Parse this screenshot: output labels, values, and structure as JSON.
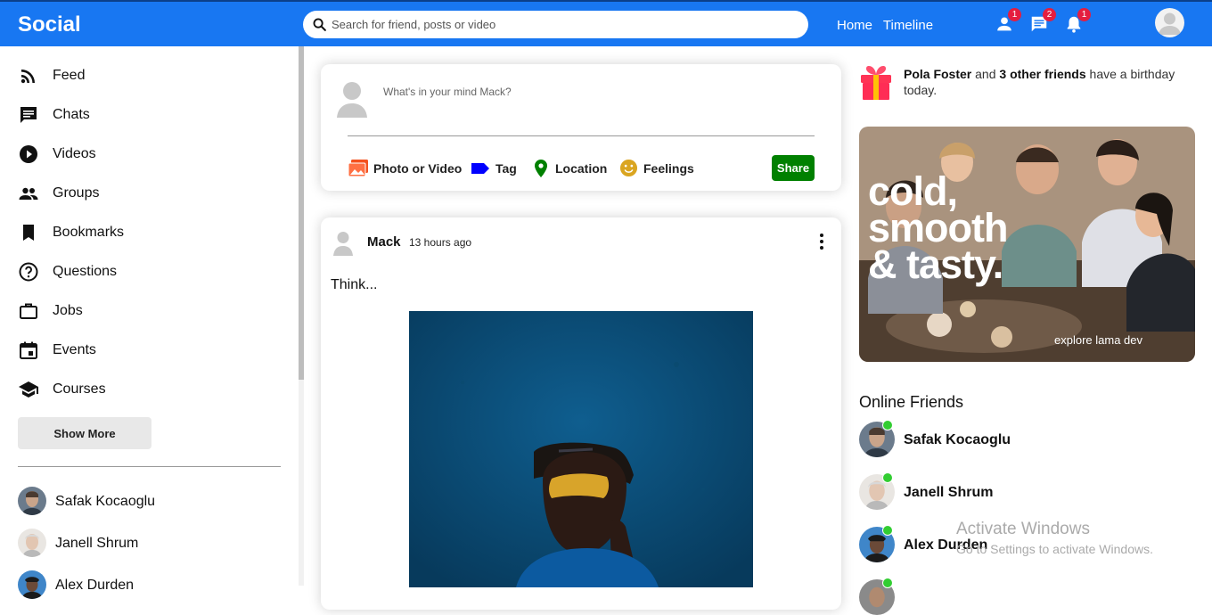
{
  "topbar": {
    "logo": "Social",
    "search_placeholder": "Search for friend, posts or video",
    "links": [
      "Home",
      "Timeline"
    ],
    "badges": {
      "person": "1",
      "chat": "2",
      "notifications": "1"
    }
  },
  "sidebar": {
    "items": [
      {
        "label": "Feed",
        "icon": "rss-feed-icon"
      },
      {
        "label": "Chats",
        "icon": "chat-icon"
      },
      {
        "label": "Videos",
        "icon": "play-circle-icon"
      },
      {
        "label": "Groups",
        "icon": "group-icon"
      },
      {
        "label": "Bookmarks",
        "icon": "bookmark-icon"
      },
      {
        "label": "Questions",
        "icon": "help-circle-icon"
      },
      {
        "label": "Jobs",
        "icon": "work-icon"
      },
      {
        "label": "Events",
        "icon": "event-icon"
      },
      {
        "label": "Courses",
        "icon": "school-icon"
      }
    ],
    "show_more": "Show More",
    "friends": [
      "Safak Kocaoglu",
      "Janell Shrum",
      "Alex Durden"
    ]
  },
  "share": {
    "placeholder": "What's in your mind Mack?",
    "options": [
      "Photo or Video",
      "Tag",
      "Location",
      "Feelings"
    ],
    "share_button": "Share"
  },
  "post": {
    "username": "Mack",
    "time": "13 hours ago",
    "text": "Think..."
  },
  "rightbar": {
    "birthday": {
      "name": "Pola Foster",
      "middle": " and ",
      "others": "3 other friends",
      "suffix": " have a birthday today."
    },
    "ad": {
      "headline_1": "cold,",
      "headline_2": "smooth",
      "headline_3": "& tasty.",
      "sub": "explore lama dev"
    },
    "online_title": "Online Friends",
    "online": [
      "Safak Kocaoglu",
      "Janell Shrum",
      "Alex Durden"
    ]
  },
  "watermark": {
    "line1": "Activate Windows",
    "line2": "Go to Settings to activate Windows."
  },
  "colors": {
    "brand": "#1877f2",
    "share_button": "#008000",
    "badge": "#e41e3f",
    "online": "#32cd32"
  }
}
